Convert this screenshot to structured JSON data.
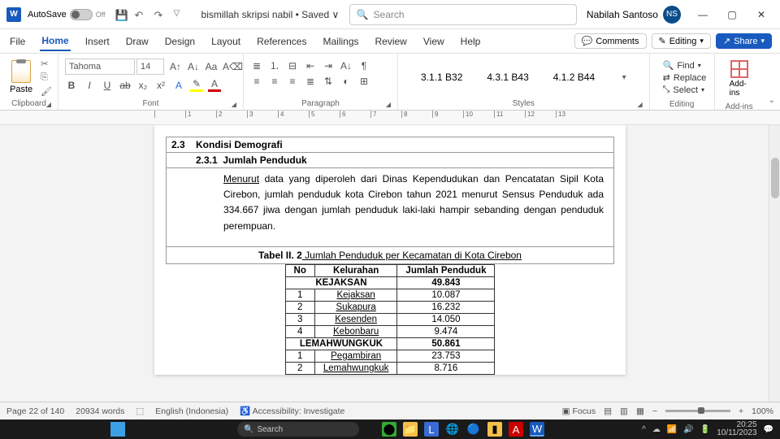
{
  "titlebar": {
    "autosave_label": "AutoSave",
    "autosave_state": "Off",
    "doc_title": "bismillah skripsi nabil • Saved ∨",
    "search_placeholder": "Search",
    "user_name": "Nabilah Santoso",
    "user_initials": "NS"
  },
  "tabs": {
    "file": "File",
    "home": "Home",
    "insert": "Insert",
    "draw": "Draw",
    "design": "Design",
    "layout": "Layout",
    "references": "References",
    "mailings": "Mailings",
    "review": "Review",
    "view": "View",
    "help": "Help",
    "comments": "Comments",
    "editing": "Editing",
    "share": "Share"
  },
  "ribbon": {
    "paste": "Paste",
    "clipboard": "Clipboard",
    "font_name": "Tahoma",
    "font_size": "14",
    "font": "Font",
    "paragraph": "Paragraph",
    "style1": "3.1.1  B32",
    "style2": "4.3.1  B43",
    "style3": "4.1.2  B44",
    "styles": "Styles",
    "find": "Find",
    "replace": "Replace",
    "select": "Select",
    "editing": "Editing",
    "addins": "Add-ins"
  },
  "document": {
    "sec_num": "2.3",
    "sec_title": "Kondisi Demografi",
    "subsec_num": "2.3.1",
    "subsec_title": "Jumlah Penduduk",
    "para": "data yang diperoleh dari Dinas Kependudukan dan Pencatatan Sipil Kota Cirebon, jumlah penduduk kota Cirebon tahun 2021 menurut Sensus Penduduk ada 334.667 jiwa dengan jumlah penduduk laki-laki hampir sebanding dengan penduduk perempuan.",
    "menurut": "Menurut",
    "table_caption_a": "Tabel II. 2",
    "table_caption_b": " Jumlah Penduduk per Kecamatan di Kota Cirebon",
    "headers": {
      "no": "No",
      "kel": "Kelurahan",
      "jml": "Jumlah Penduduk"
    },
    "rows": [
      {
        "no": "",
        "kel": "KEJAKSAN",
        "jml": "49.843",
        "kec": true
      },
      {
        "no": "1",
        "kel": "Kejaksan",
        "jml": "10.087"
      },
      {
        "no": "2",
        "kel": "Sukapura",
        "jml": "16.232"
      },
      {
        "no": "3",
        "kel": "Kesenden",
        "jml": "14.050"
      },
      {
        "no": "4",
        "kel": "Kebonbaru",
        "jml": "9.474"
      },
      {
        "no": "",
        "kel": "LEMAHWUNGKUK",
        "jml": "50.861",
        "kec": true
      },
      {
        "no": "1",
        "kel": "Pegambiran",
        "jml": "23.753"
      },
      {
        "no": "2",
        "kel": "Lemahwungkuk",
        "jml": "8.716"
      }
    ]
  },
  "status": {
    "page": "Page 22 of 140",
    "words": "20934 words",
    "lang": "English (Indonesia)",
    "access": "Accessibility: Investigate",
    "focus": "Focus",
    "zoom": "100%"
  },
  "taskbar": {
    "search": "Search",
    "time": "20:25",
    "date": "10/11/2023"
  }
}
